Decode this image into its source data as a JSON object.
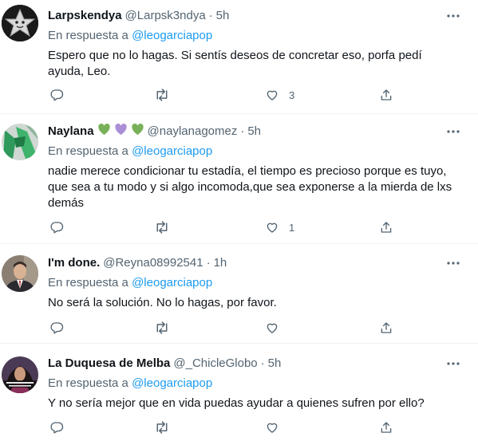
{
  "colors": {
    "link": "#1d9bf0",
    "secondary": "#536471",
    "text": "#0f1419",
    "divider": "#eff3f4",
    "heart_emoji": "#78b159",
    "purple_heart_emoji": "#aa8ed6"
  },
  "icons": {
    "more": "more-horizontal-icon",
    "reply": "reply-bubble-icon",
    "retweet": "retweet-icon",
    "like": "heart-outline-icon",
    "share": "share-upload-icon"
  },
  "tweets": [
    {
      "name": "Larpskendya",
      "handle": "@Larpsk3ndya",
      "dot": "·",
      "time": "5h",
      "reply_prefix": "En respuesta a",
      "reply_to": "@leogarciapop",
      "text_lines": [
        "Espero que no lo hagas. Si sentís deseos de concretar eso, porfa pedí",
        "ayuda, Leo."
      ],
      "replies": "",
      "retweets": "",
      "likes": "3"
    },
    {
      "name": "Naylana",
      "emoji": [
        "green heart",
        "purple heart",
        "green heart"
      ],
      "handle": "@naylanagomez",
      "dot": "·",
      "time": "5h",
      "reply_prefix": "En respuesta a",
      "reply_to": "@leogarciapop",
      "text_lines": [
        "nadie merece condicionar tu estadía, el tiempo es precioso porque es tuyo,",
        "que sea a tu modo y si algo incomoda,que sea exponerse a la mierda de lxs",
        "demás"
      ],
      "replies": "",
      "retweets": "",
      "likes": "1"
    },
    {
      "name": "I'm done.",
      "handle": "@Reyna08992541",
      "dot": "·",
      "time": "1h",
      "reply_prefix": "En respuesta a",
      "reply_to": "@leogarciapop",
      "text_lines": [
        "No será la solución. No lo hagas, por favor."
      ],
      "replies": "",
      "retweets": "",
      "likes": ""
    },
    {
      "name": "La Duquesa de Melba",
      "handle": "@_ChicleGlobo",
      "dot": "·",
      "time": "5h",
      "reply_prefix": "En respuesta a",
      "reply_to": "@leogarciapop",
      "text_lines": [
        "Y no sería mejor que en vida puedas ayudar a quienes sufren por ello?"
      ],
      "replies": "",
      "retweets": "",
      "likes": ""
    }
  ]
}
